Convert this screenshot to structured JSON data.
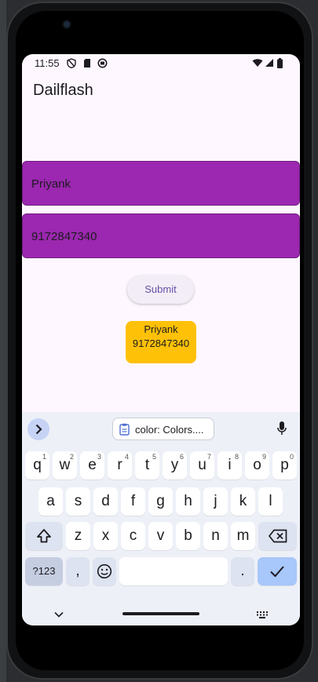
{
  "status": {
    "time": "11:55"
  },
  "app": {
    "title": "Dailflash"
  },
  "form": {
    "name_value": "Priyank",
    "phone_value": "9172847340",
    "submit_label": "Submit"
  },
  "result": {
    "name": "Priyank",
    "phone": "9172847340"
  },
  "keyboard": {
    "clipboard_text": "color: Colors....",
    "row1": [
      {
        "label": "q",
        "hint": "1"
      },
      {
        "label": "w",
        "hint": "2"
      },
      {
        "label": "e",
        "hint": "3"
      },
      {
        "label": "r",
        "hint": "4"
      },
      {
        "label": "t",
        "hint": "5"
      },
      {
        "label": "y",
        "hint": "6"
      },
      {
        "label": "u",
        "hint": "7"
      },
      {
        "label": "i",
        "hint": "8"
      },
      {
        "label": "o",
        "hint": "9"
      },
      {
        "label": "p",
        "hint": "0"
      }
    ],
    "row2": [
      "a",
      "s",
      "d",
      "f",
      "g",
      "h",
      "j",
      "k",
      "l"
    ],
    "row3": [
      "z",
      "x",
      "c",
      "v",
      "b",
      "n",
      "m"
    ],
    "symbols_label": "?123",
    "comma_label": ",",
    "period_label": "."
  },
  "colors": {
    "field_bg": "#9c27b0",
    "result_bg": "#ffc107",
    "screen_bg": "#fef7ff",
    "keyboard_bg": "#edf0f7",
    "accent_key": "#a8c7fa"
  },
  "icons": {
    "status": [
      "shield-icon",
      "sim-card-icon",
      "sync-icon",
      "wifi-icon",
      "signal-icon",
      "battery-icon"
    ],
    "keyboard": [
      "chevron-right-icon",
      "clipboard-icon",
      "mic-icon",
      "shift-icon",
      "backspace-icon",
      "emoji-icon",
      "check-icon",
      "chevron-down-icon",
      "keyboard-grid-icon"
    ]
  }
}
